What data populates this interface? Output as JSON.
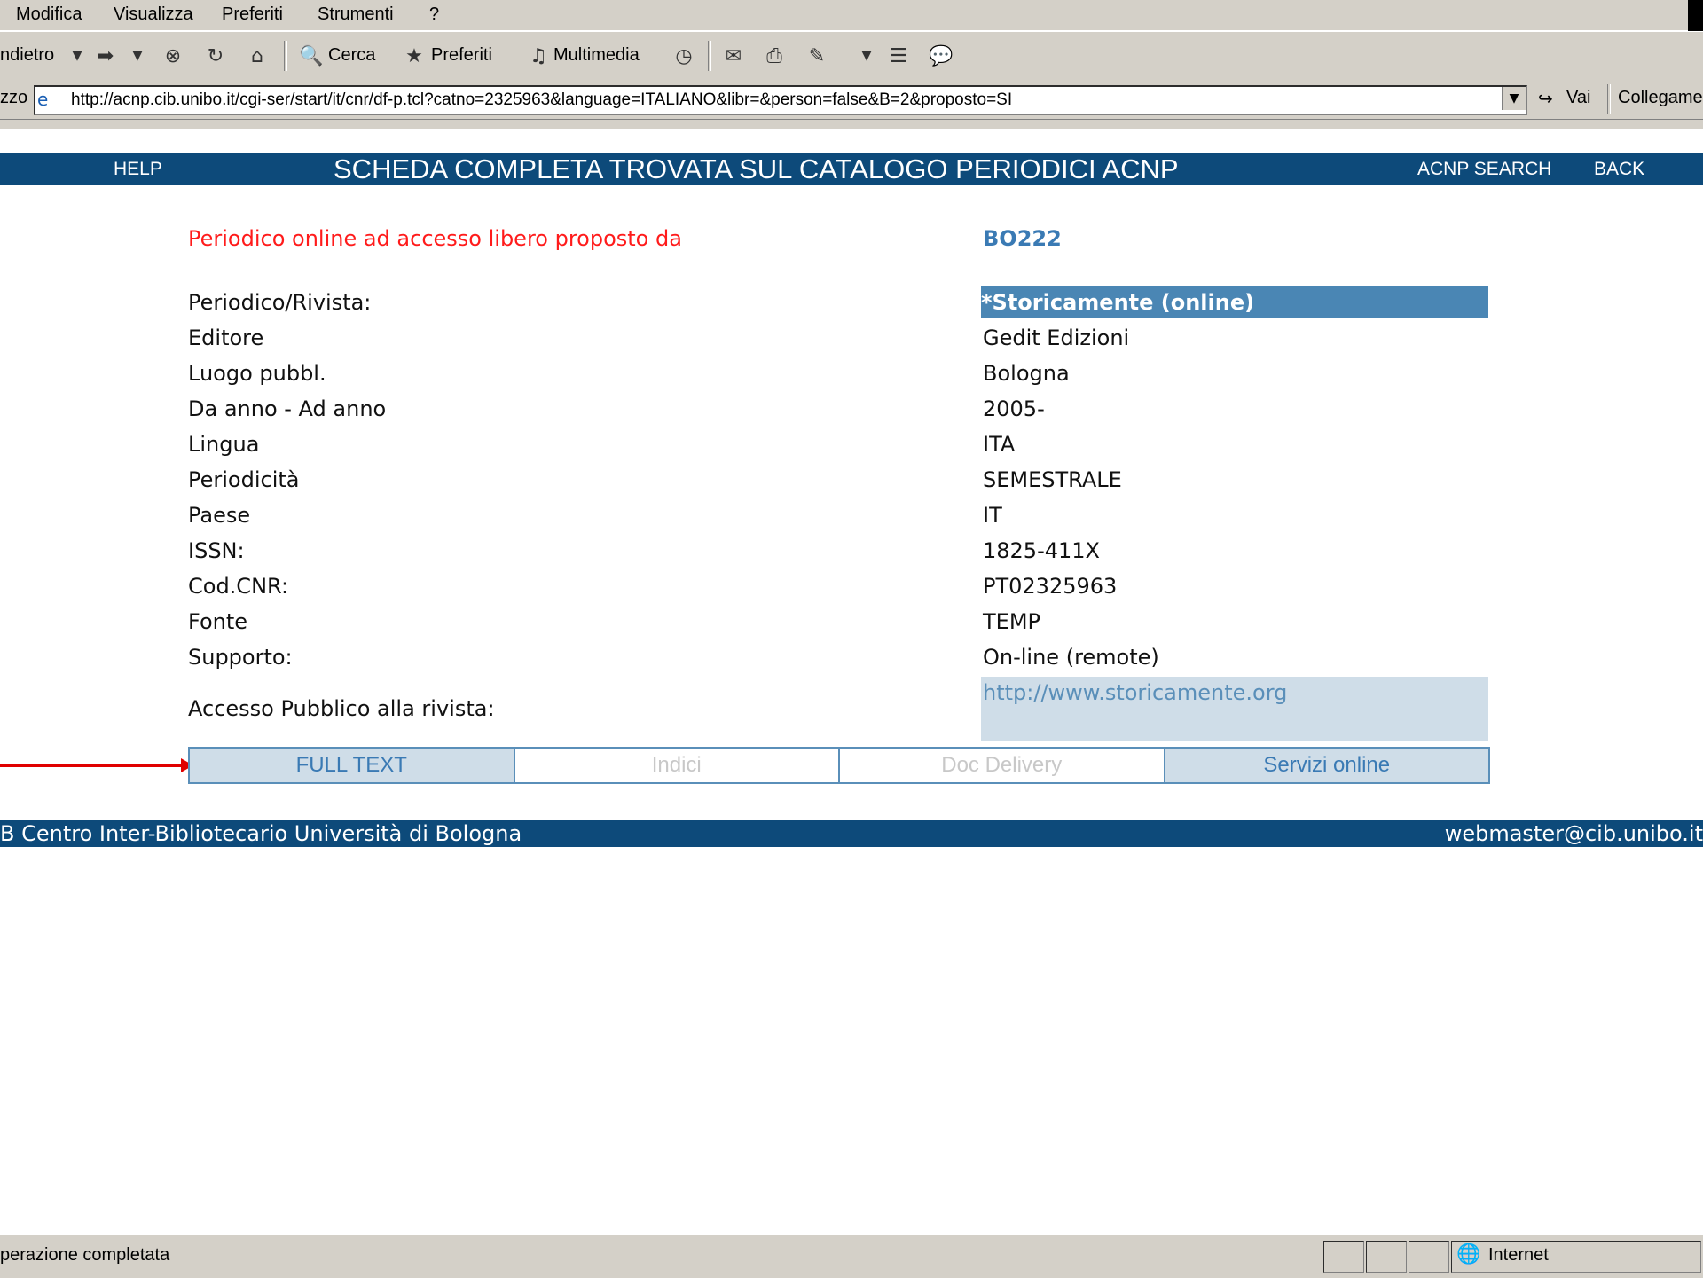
{
  "menu": [
    "Modifica",
    "Visualizza",
    "Preferiti",
    "Strumenti",
    "?"
  ],
  "toolbar": {
    "back_label": "ndietro",
    "search_label": "Cerca",
    "favorites_label": "Preferiti",
    "media_label": "Multimedia"
  },
  "address": {
    "label": "zzo",
    "url": "http://acnp.cib.unibo.it/cgi-ser/start/it/cnr/df-p.tcl?catno=2325963&language=ITALIANO&libr=&person=false&B=2&proposto=SI",
    "go_label": "Vai",
    "links_label": "Collegame"
  },
  "header": {
    "help": "HELP",
    "title": "SCHEDA COMPLETA TROVATA SUL CATALOGO PERIODICI ACNP",
    "search": "ACNP SEARCH",
    "back": "BACK"
  },
  "record": {
    "proposal_text": "Periodico online ad accesso libero proposto da",
    "proposal_code": "BO222",
    "fields": [
      {
        "label": "Periodico/Rivista:",
        "value": "*Storicamente (online)"
      },
      {
        "label": "Editore",
        "value": "Gedit Edizioni"
      },
      {
        "label": "Luogo pubbl.",
        "value": "Bologna"
      },
      {
        "label": "Da anno - Ad anno",
        "value": "2005-"
      },
      {
        "label": "Lingua",
        "value": "ITA"
      },
      {
        "label": "Periodicità",
        "value": "SEMESTRALE"
      },
      {
        "label": "Paese",
        "value": "IT"
      },
      {
        "label": "ISSN:",
        "value": "1825-411X"
      },
      {
        "label": "Cod.CNR:",
        "value": "PT02325963"
      },
      {
        "label": "Fonte",
        "value": "TEMP"
      },
      {
        "label": "Supporto:",
        "value": "On-line (remote)"
      }
    ],
    "access_label": "Accesso Pubblico alla rivista:",
    "access_url": "http://www.storicamente.org"
  },
  "tabs": [
    "FULL TEXT",
    "Indici",
    "Doc Delivery",
    "Servizi online"
  ],
  "footer": {
    "left": "B Centro Inter-Bibliotecario Università di Bologna",
    "right": "webmaster@cib.unibo.it"
  },
  "status": {
    "text": "perazione completata",
    "zone": "Internet"
  },
  "colors": {
    "header_bg": "#0d4a7a",
    "accent": "#4a86b4",
    "red": "#ff1b1b",
    "arrow": "#e00000"
  }
}
